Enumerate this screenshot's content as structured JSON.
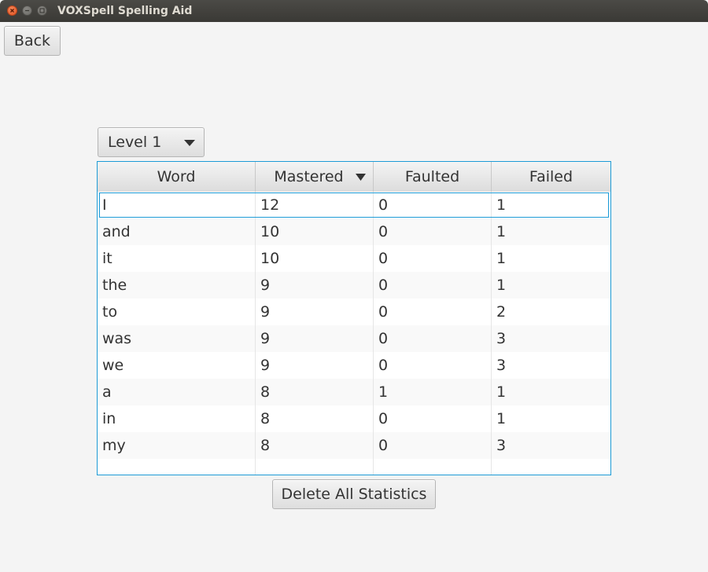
{
  "window": {
    "title": "VOXSpell Spelling Aid"
  },
  "toolbar": {
    "back_label": "Back"
  },
  "level_select": {
    "selected": "Level 1"
  },
  "table": {
    "columns": [
      "Word",
      "Mastered",
      "Faulted",
      "Failed"
    ],
    "sorted_column": "Mastered",
    "sort_direction": "descending",
    "rows": [
      {
        "word": "I",
        "mastered": "12",
        "faulted": "0",
        "failed": "1"
      },
      {
        "word": "and",
        "mastered": "10",
        "faulted": "0",
        "failed": "1"
      },
      {
        "word": "it",
        "mastered": "10",
        "faulted": "0",
        "failed": "1"
      },
      {
        "word": "the",
        "mastered": "9",
        "faulted": "0",
        "failed": "1"
      },
      {
        "word": "to",
        "mastered": "9",
        "faulted": "0",
        "failed": "2"
      },
      {
        "word": "was",
        "mastered": "9",
        "faulted": "0",
        "failed": "3"
      },
      {
        "word": "we",
        "mastered": "9",
        "faulted": "0",
        "failed": "3"
      },
      {
        "word": "a",
        "mastered": "8",
        "faulted": "1",
        "failed": "1"
      },
      {
        "word": "in",
        "mastered": "8",
        "faulted": "0",
        "failed": "1"
      },
      {
        "word": "my",
        "mastered": "8",
        "faulted": "0",
        "failed": "3"
      }
    ]
  },
  "actions": {
    "delete_label": "Delete All Statistics"
  },
  "colors": {
    "focus_accent": "#1d9bd6",
    "close_button": "#e0501f",
    "titlebar": "#3c3b37"
  },
  "icons": {
    "combo_arrow": "chevron-down-icon",
    "sort_indicator": "sort-descending-icon"
  }
}
